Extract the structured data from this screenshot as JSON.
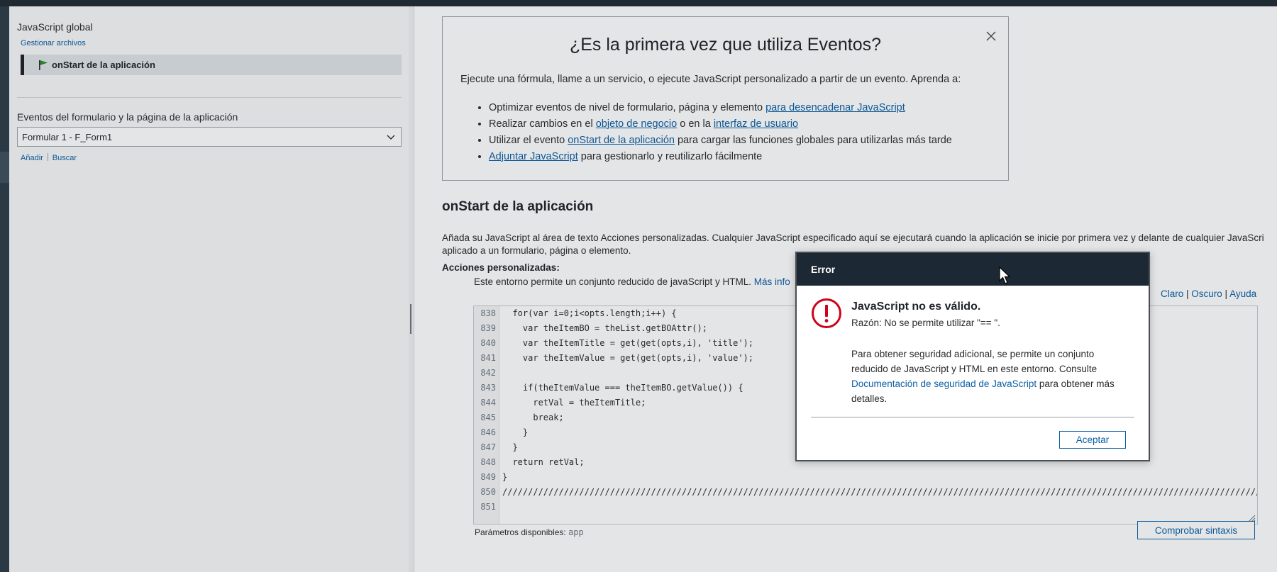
{
  "colors": {
    "accent": "#0b5fa5",
    "dialog_header": "#1c2833",
    "error_red": "#d0021b",
    "flag_green": "#2e8b2e",
    "topbar": "#1f2a33"
  },
  "sidebar": {
    "title": "JavaScript global",
    "manage_files": "Gestionar archivos",
    "selected_item": {
      "label": "onStart de la aplicación",
      "icon": "flag-icon"
    },
    "section_title": "Eventos del formulario y la página de la aplicación",
    "form_select": {
      "value": "Formular 1 - F_Form1"
    },
    "actions": {
      "add": "Añadir",
      "search": "Buscar"
    }
  },
  "info_box": {
    "title": "¿Es la primera vez que utiliza Eventos?",
    "description": "Ejecute una fórmula, llame a un servicio, o ejecute JavaScript personalizado a partir de un evento. Aprenda a:",
    "items": [
      {
        "pre": "Optimizar eventos de nivel de formulario, página y elemento ",
        "link": "para desencadenar JavaScript",
        "post": ""
      },
      {
        "pre": "Realizar cambios en el ",
        "link": "objeto de negocio",
        "mid": " o en la ",
        "link2": "interfaz de usuario",
        "post": ""
      },
      {
        "pre": "Utilizar el evento ",
        "link": "onStart de la aplicación",
        "post": " para cargar las funciones globales para utilizarlas más tarde"
      },
      {
        "pre": "",
        "link": "Adjuntar JavaScript",
        "post": " para gestionarlo y reutilizarlo fácilmente"
      }
    ]
  },
  "section": {
    "title": "onStart de la aplicación",
    "description_line1": "Añada su JavaScript al área de texto Acciones personalizadas. Cualquier JavaScript especificado aquí se ejecutará cuando la aplicación se inicie por primera vez y delante de cualquier JavaScri",
    "description_line2": "aplicado a un formulario, página o elemento.",
    "custom_actions_label": "Acciones personalizadas:",
    "env_note": "Este entorno permite un conjunto reducido de javaScript y HTML. ",
    "more_info": "Más info",
    "themes": {
      "light": "Claro",
      "dark": "Oscuro",
      "help": "Ayuda"
    }
  },
  "editor": {
    "lines": [
      {
        "n": "838",
        "code": "  for(var i=0;i<opts.length;i++) {"
      },
      {
        "n": "839",
        "code": "    var theItemBO = theList.getBOAttr();"
      },
      {
        "n": "840",
        "code": "    var theItemTitle = get(get(opts,i), 'title');"
      },
      {
        "n": "841",
        "code": "    var theItemValue = get(get(opts,i), 'value');"
      },
      {
        "n": "842",
        "code": ""
      },
      {
        "n": "843",
        "code": "    if(theItemValue === theItemBO.getValue()) {"
      },
      {
        "n": "844",
        "code": "      retVal = theItemTitle;"
      },
      {
        "n": "845",
        "code": "      break;"
      },
      {
        "n": "846",
        "code": "    }"
      },
      {
        "n": "847",
        "code": "  }"
      },
      {
        "n": "848",
        "code": "  return retVal;"
      },
      {
        "n": "849",
        "code": "}"
      },
      {
        "n": "850",
        "code": "////////////////////////////////////////////////////////////////////////////////////////////////////////////////////////////////////////////////////////////////////////"
      },
      {
        "n": "851",
        "code": ""
      }
    ]
  },
  "footer": {
    "params_label": "Parámetros disponibles: ",
    "params_value": "app",
    "check_syntax": "Comprobar sintaxis"
  },
  "dialog": {
    "title": "Error",
    "heading": "JavaScript no es válido.",
    "reason": "Razón: No se permite utilizar \"== \".",
    "body_pre": "Para obtener seguridad adicional, se permite un conjunto reducido de JavaScript y HTML en este entorno. Consulte ",
    "body_link": "Documentación de seguridad de JavaScript",
    "body_post": " para obtener más detalles.",
    "ok": "Aceptar"
  }
}
